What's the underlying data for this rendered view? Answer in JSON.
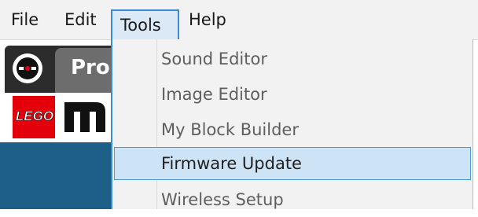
{
  "menubar": {
    "items": [
      {
        "label": "File"
      },
      {
        "label": "Edit"
      },
      {
        "label": "Tools"
      },
      {
        "label": "Help"
      }
    ]
  },
  "app": {
    "tab_label": "Pro",
    "lego_logo_text": "LEGO"
  },
  "tools_menu": {
    "items": [
      {
        "label": "Sound Editor",
        "state": "normal"
      },
      {
        "label": "Image Editor",
        "state": "normal"
      },
      {
        "label": "My Block Builder",
        "state": "normal"
      },
      {
        "label": "Firmware Update",
        "state": "highlighted"
      },
      {
        "label": "Wireless Setup",
        "state": "normal"
      }
    ]
  },
  "colors": {
    "menu_highlight": "#cde4f7",
    "menu_border": "#3a8ad6",
    "canvas_blue": "#1d5f86",
    "lego_red": "#e3000b"
  }
}
